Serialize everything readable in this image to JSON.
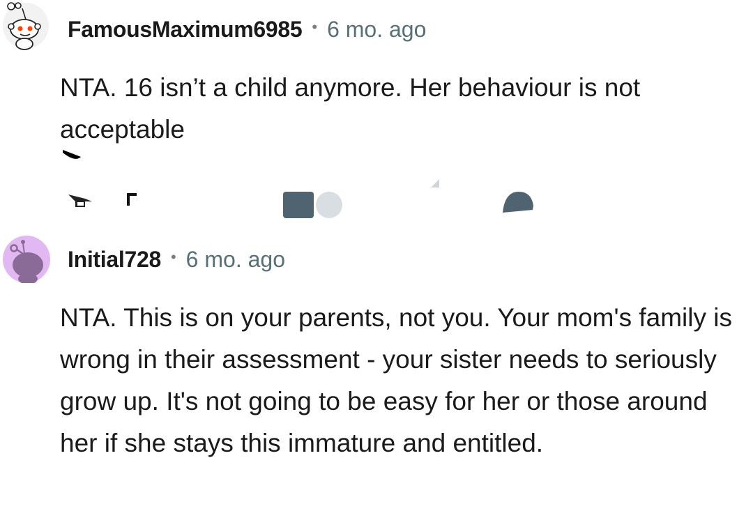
{
  "comments": [
    {
      "username": "FamousMaximum6985",
      "separator": "•",
      "time": "6 mo. ago",
      "body": "NTA. 16 isn’t a child anymore. Her behaviour is not acceptable",
      "avatar_icon": "snoo-avatar-icon"
    },
    {
      "username": "Initial728",
      "separator": "•",
      "time": "6 mo. ago",
      "body": "NTA. This is on your parents, not you. Your mom's family is wrong in their assessment - your sister needs to seriously grow up. It's not going to be easy for her or those around her if she stays this immature and entitled.",
      "avatar_icon": "snoo-purple-avatar-icon"
    }
  ],
  "action_icons": [
    "upvote-icon",
    "downvote-icon",
    "award-icon",
    "share-icon",
    "reply-icon"
  ],
  "colors": {
    "icon_dark": "#4f6470",
    "icon_light": "#d8dee2",
    "purple_avatar": "#e2b8f2",
    "meta_text": "#576f76"
  }
}
